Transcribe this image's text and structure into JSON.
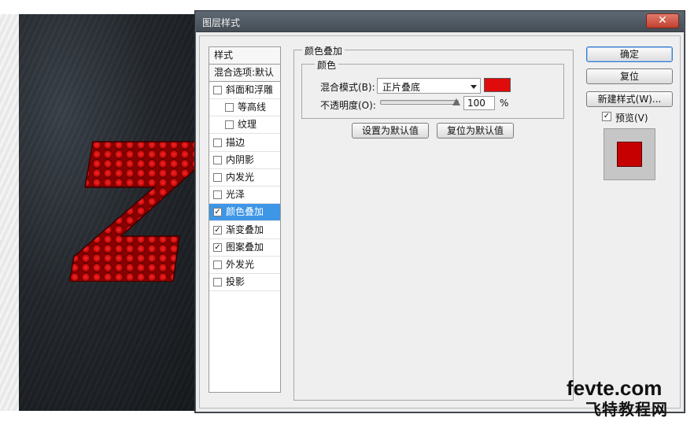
{
  "dialog": {
    "title": "图层样式",
    "close_label": "✕"
  },
  "style_list": {
    "header": "样式",
    "blend": "混合选项:默认",
    "items": [
      {
        "label": "斜面和浮雕",
        "checked": false,
        "indent": false
      },
      {
        "label": "等高线",
        "checked": false,
        "indent": true
      },
      {
        "label": "纹理",
        "checked": false,
        "indent": true
      },
      {
        "label": "描边",
        "checked": false,
        "indent": false
      },
      {
        "label": "内阴影",
        "checked": false,
        "indent": false
      },
      {
        "label": "内发光",
        "checked": false,
        "indent": false
      },
      {
        "label": "光泽",
        "checked": false,
        "indent": false
      },
      {
        "label": "颜色叠加",
        "checked": true,
        "indent": false,
        "selected": true
      },
      {
        "label": "渐变叠加",
        "checked": true,
        "indent": false
      },
      {
        "label": "图案叠加",
        "checked": true,
        "indent": false
      },
      {
        "label": "外发光",
        "checked": false,
        "indent": false
      },
      {
        "label": "投影",
        "checked": false,
        "indent": false
      }
    ]
  },
  "panel": {
    "group_title": "颜色叠加",
    "subgroup_title": "颜色",
    "blend_mode_label": "混合模式(B):",
    "blend_mode_value": "正片叠底",
    "overlay_color": "#e00b0b",
    "opacity_label": "不透明度(O):",
    "opacity_value": "100",
    "opacity_fraction": 1.0,
    "opacity_unit": "%",
    "set_default_label": "设置为默认值",
    "reset_default_label": "复位为默认值"
  },
  "buttons": {
    "ok": "确定",
    "reset": "复位",
    "new_style": "新建样式(W)..."
  },
  "preview": {
    "checked": true,
    "label": "预览(V)"
  },
  "watermark": {
    "line1": "fevte.com",
    "line2": "飞特教程网"
  },
  "check_glyph": "✓",
  "canvas_letter": "Z"
}
